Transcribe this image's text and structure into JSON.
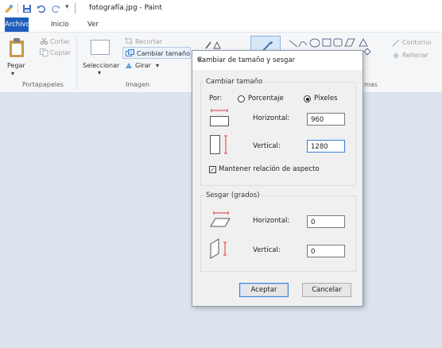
{
  "window": {
    "title": "fotografía.jpg - Paint"
  },
  "tabs": {
    "file": "Archivo",
    "home": "Inicio",
    "view": "Ver"
  },
  "ribbon": {
    "clipboard": {
      "paste": "Pegar",
      "cut": "Cortar",
      "copy": "Copiar",
      "label": "Portapapeles"
    },
    "image": {
      "select": "Seleccionar",
      "crop": "Recortar",
      "resize": "Cambiar tamaño",
      "rotate": "Girar",
      "label": "Imagen"
    },
    "shapes": {
      "outline": "Contorno",
      "fill": "Rellenar",
      "label_fragment": "mas"
    }
  },
  "dialog": {
    "title": "Cambiar de tamaño y sesgar",
    "resize_group": "Cambiar tamaño",
    "by_label": "Por:",
    "percent_option": "Porcentaje",
    "pixels_option": "Píxeles",
    "horizontal_label": "Horizontal:",
    "vertical_label": "Vertical:",
    "horizontal_value": "960",
    "vertical_value": "1280",
    "keep_ratio": "Mantener relación de aspecto",
    "skew_group": "Sesgar (grados)",
    "skew_horizontal_label": "Horizontal:",
    "skew_vertical_label": "Vertical:",
    "skew_horizontal_value": "0",
    "skew_vertical_value": "0",
    "ok": "Aceptar",
    "cancel": "Cancelar"
  },
  "colors": {
    "file_tab": "#1e5fbd",
    "accent": "#3c7fd6",
    "red_arrow": "#e0383c",
    "canvas": "#dbe3ee"
  }
}
